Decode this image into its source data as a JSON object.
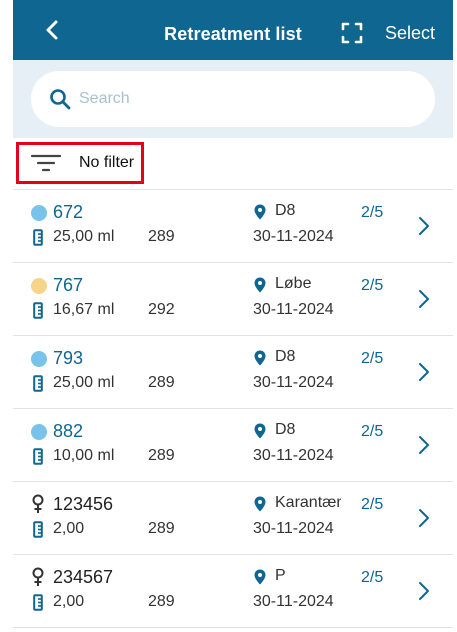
{
  "header": {
    "title": "Retreatment list",
    "select_label": "Select"
  },
  "search": {
    "placeholder": "Search",
    "value": ""
  },
  "filter": {
    "label": "No filter"
  },
  "colors": {
    "header_bg": "#0f6690",
    "accent": "#0f6690",
    "dot_blue": "#79c3ea",
    "dot_yellow": "#f6d48a",
    "filter_border": "#e3001b"
  },
  "rows": [
    {
      "marker": "dot",
      "marker_color": "#79c3ea",
      "number": "672",
      "volume": "25,00 ml",
      "code": "289",
      "location": "D8",
      "date": "30-11-2024",
      "progress": "2/5"
    },
    {
      "marker": "dot",
      "marker_color": "#f6d48a",
      "number": "767",
      "volume": "16,67 ml",
      "code": "292",
      "location": "Løbe",
      "date": "30-11-2024",
      "progress": "2/5"
    },
    {
      "marker": "dot",
      "marker_color": "#79c3ea",
      "number": "793",
      "volume": "25,00 ml",
      "code": "289",
      "location": "D8",
      "date": "30-11-2024",
      "progress": "2/5"
    },
    {
      "marker": "dot",
      "marker_color": "#79c3ea",
      "number": "882",
      "volume": "10,00 ml",
      "code": "289",
      "location": "D8",
      "date": "30-11-2024",
      "progress": "2/5"
    },
    {
      "marker": "female",
      "marker_color": "#333333",
      "number": "123456",
      "volume": "2,00",
      "code": "289",
      "location": "Karantæne",
      "date": "30-11-2024",
      "progress": "2/5"
    },
    {
      "marker": "female",
      "marker_color": "#333333",
      "number": "234567",
      "volume": "2,00",
      "code": "289",
      "location": "P",
      "date": "30-11-2024",
      "progress": "2/5"
    }
  ]
}
